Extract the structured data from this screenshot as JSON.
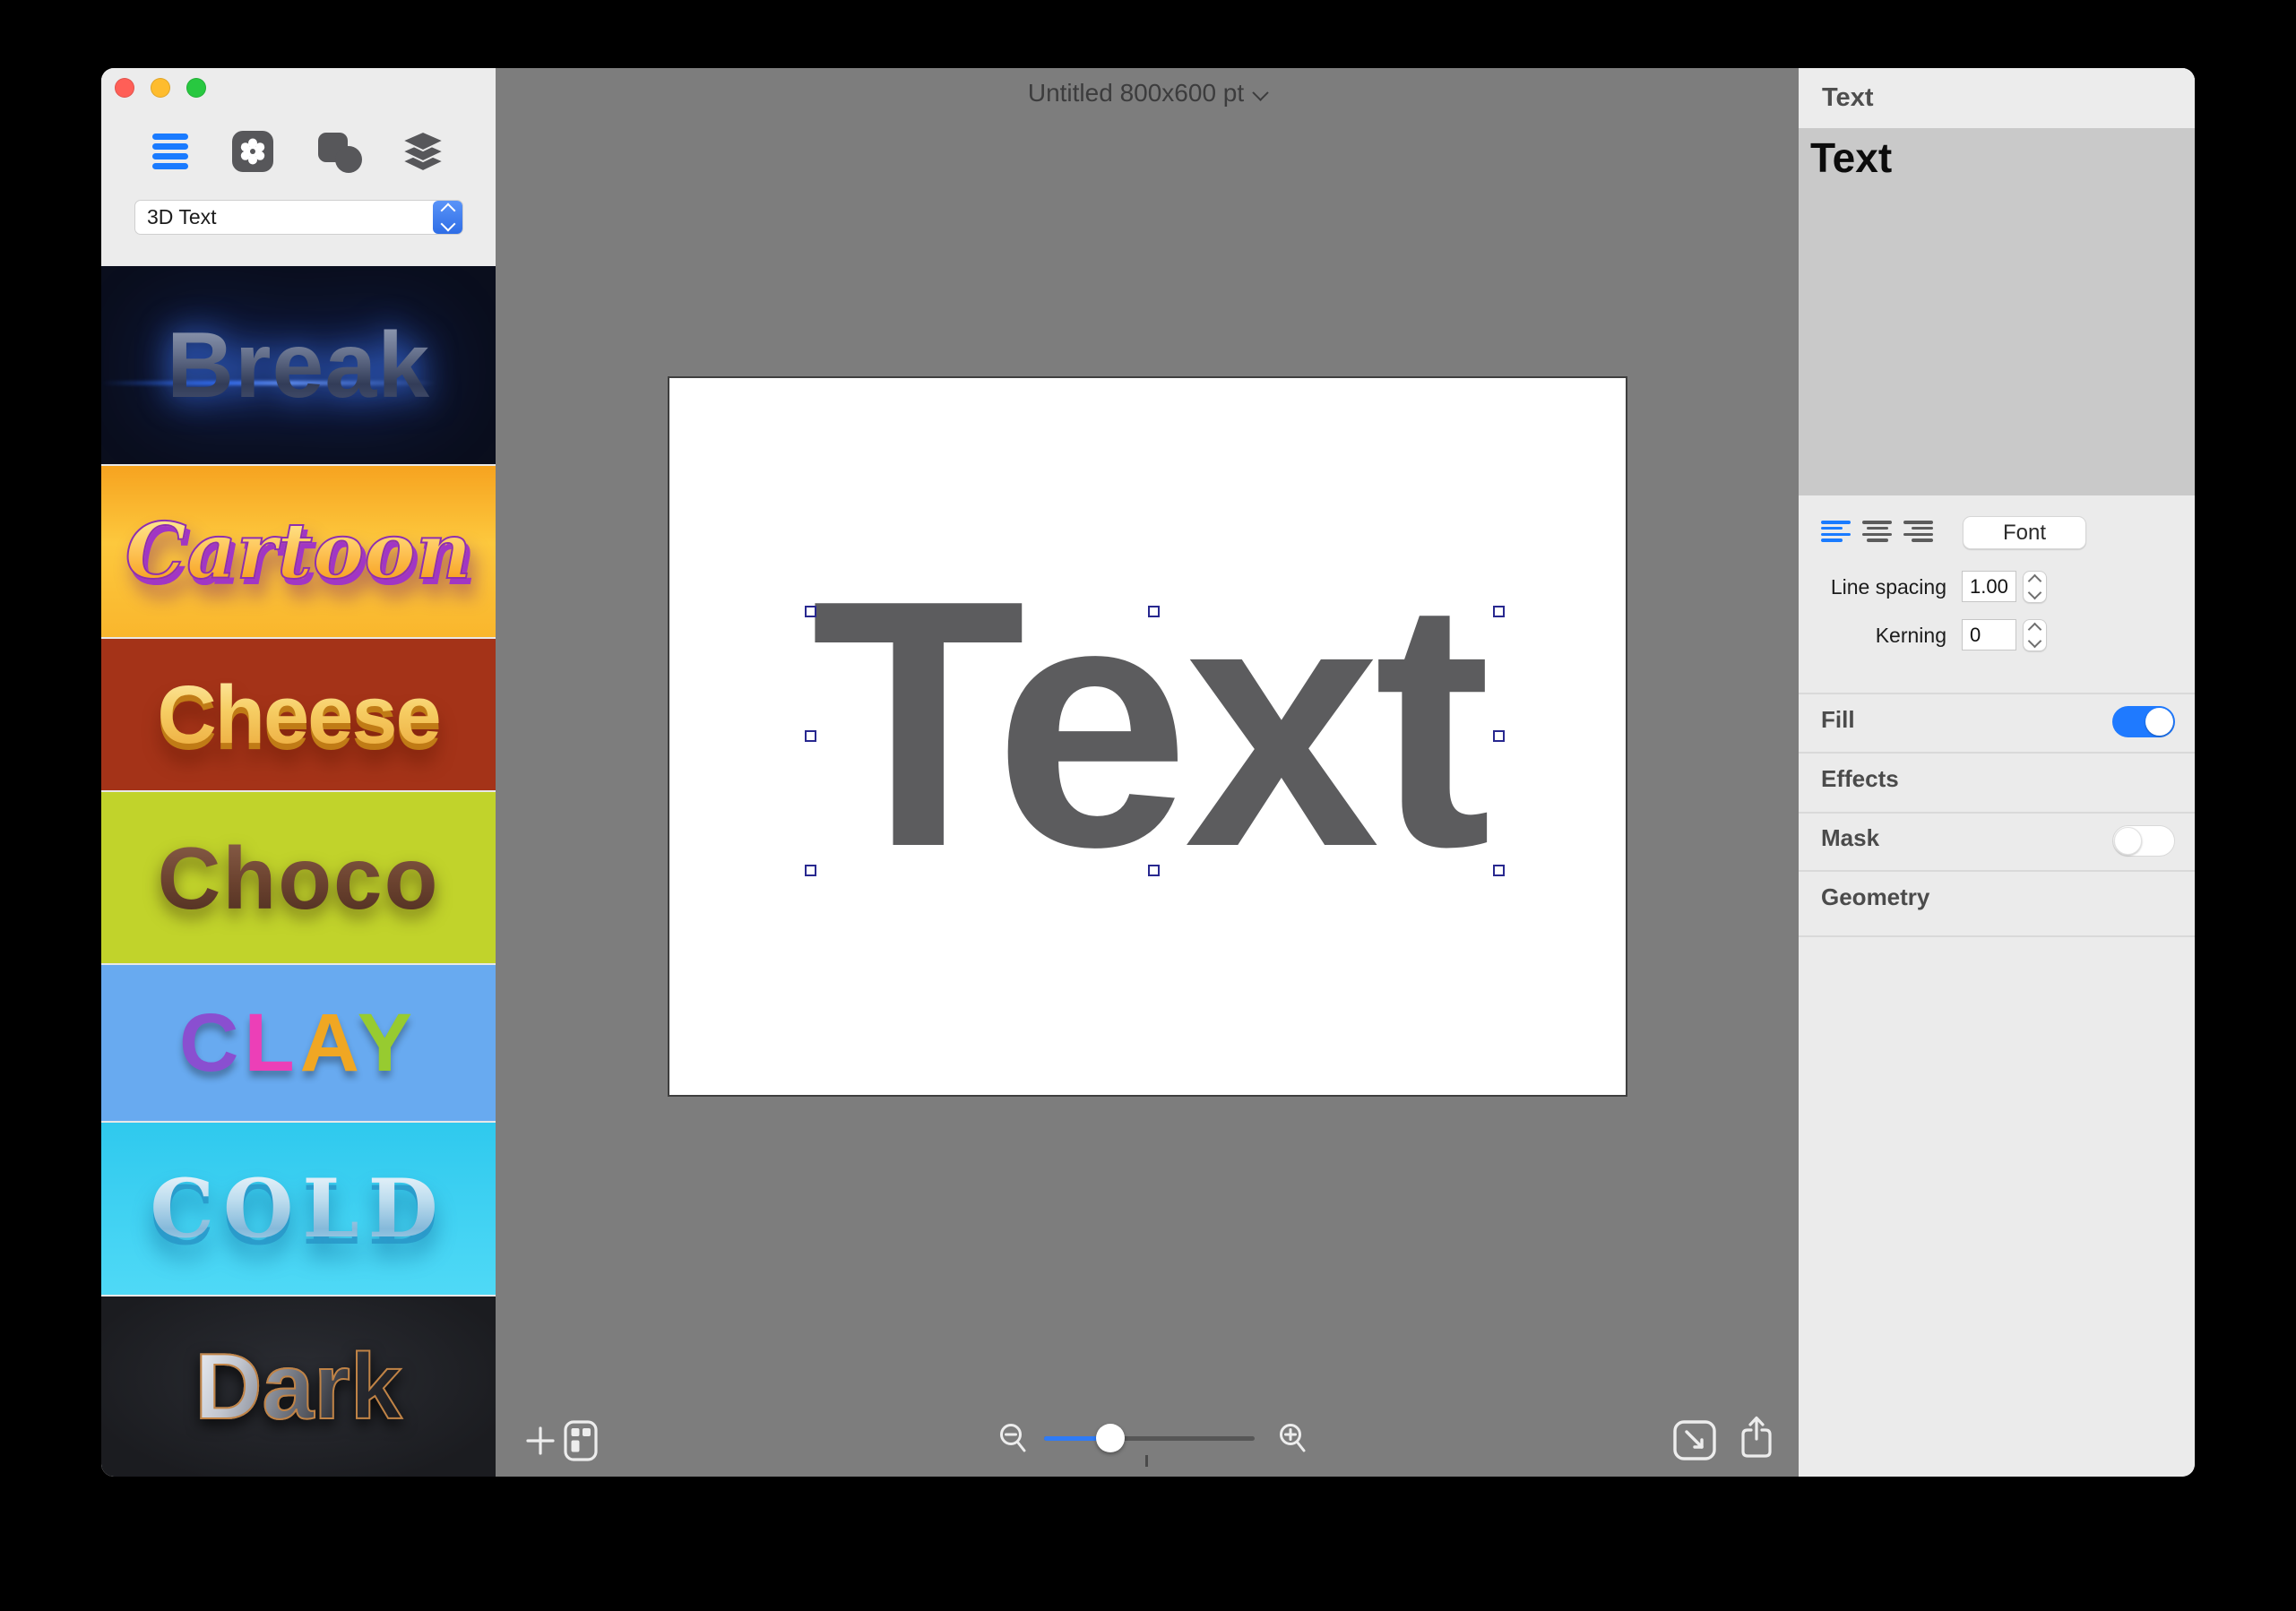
{
  "window": {
    "title": "Untitled 800x600 pt",
    "traffic_lights": {
      "close": "#ff5f57",
      "minimize": "#febc2e",
      "zoom": "#28c840"
    }
  },
  "sidebar": {
    "tools": [
      "styles-list",
      "templates",
      "shapes",
      "layers"
    ],
    "style_selector_value": "3D Text",
    "presets": [
      {
        "label": "Break",
        "bg": "#0a0e1d"
      },
      {
        "label": "Cartoon",
        "bg": "#fcb827"
      },
      {
        "label": "Cheese",
        "bg": "#a43318"
      },
      {
        "label": "Choco",
        "bg": "#c1d32b"
      },
      {
        "label": "CLAY",
        "bg": "#68aaf0",
        "letters": [
          "C",
          "L",
          "A",
          "Y"
        ],
        "letter_colors": [
          "#8a4fd0",
          "#ec3fb7",
          "#f0a723",
          "#97cb30"
        ]
      },
      {
        "label": "COLD",
        "bg": "#3ed2f2"
      },
      {
        "label": "Dark",
        "bg": "#212327"
      }
    ]
  },
  "canvas": {
    "doc_title": "Untitled 800x600 pt",
    "artboard_text": "Text"
  },
  "inspector": {
    "tab_title": "Text",
    "text_preview": "Text",
    "font_button": "Font",
    "line_spacing_label": "Line spacing",
    "line_spacing_value": "1.00",
    "kerning_label": "Kerning",
    "kerning_value": "0",
    "sections": [
      {
        "label": "Fill",
        "toggle": "on"
      },
      {
        "label": "Effects",
        "toggle": null
      },
      {
        "label": "Mask",
        "toggle": "off"
      },
      {
        "label": "Geometry",
        "toggle": null
      }
    ]
  },
  "colors": {
    "accent_blue": "#1a7bff",
    "toggle_on": "#1f7aff",
    "canvas_gray": "#7d7d7d",
    "panel_bg": "#ececec",
    "preview_bg": "#c9c9c9",
    "artboard_text_color": "#5c5c5e",
    "selection_handle": "#28288f"
  }
}
